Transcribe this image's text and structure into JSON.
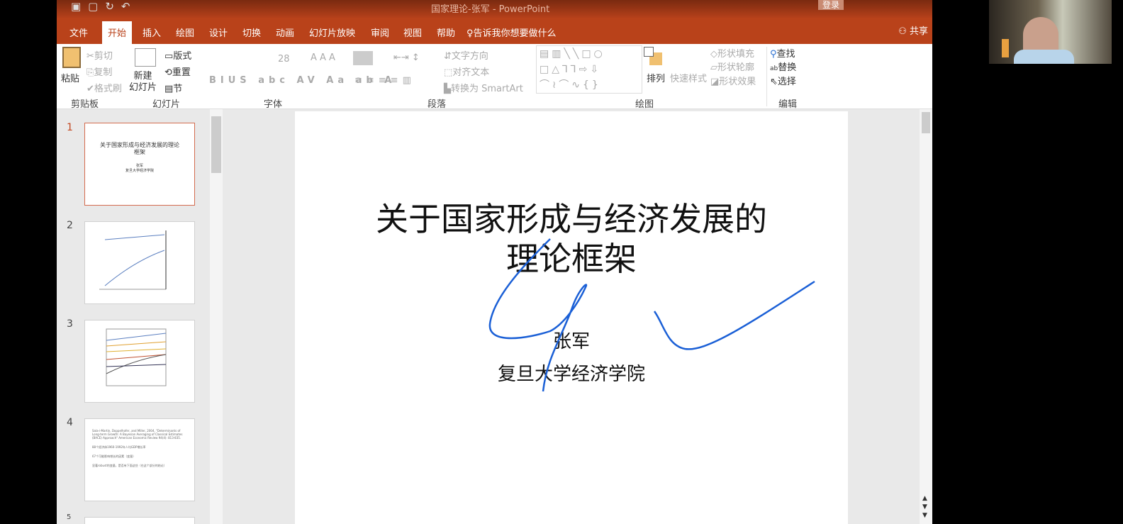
{
  "window": {
    "title": "国家理论-张军  -  PowerPoint",
    "login": "登录",
    "share": "共享"
  },
  "tabs": [
    "文件",
    "开始",
    "插入",
    "绘图",
    "设计",
    "切换",
    "动画",
    "幻灯片放映",
    "审阅",
    "视图",
    "帮助"
  ],
  "tell_me": "告诉我你想要做什么",
  "ribbon": {
    "clipboard": {
      "paste": "粘贴",
      "cut": "剪切",
      "copy": "复制",
      "format_painter": "格式刷",
      "label": "剪贴板"
    },
    "slides": {
      "new_slide": "新建\n幻灯片",
      "layout": "版式",
      "reset": "重置",
      "section": "节",
      "label": "幻灯片"
    },
    "font": {
      "size": "28",
      "label": "字体"
    },
    "paragraph": {
      "text_direction": "文字方向",
      "align_text": "对齐文本",
      "smartart": "转换为 SmartArt",
      "label": "段落"
    },
    "drawing": {
      "arrange": "排列",
      "quick_styles": "快速样式",
      "shape_fill": "形状填充",
      "shape_outline": "形状轮廓",
      "shape_effects": "形状效果",
      "label": "绘图"
    },
    "editing": {
      "find": "查找",
      "replace": "替换",
      "select": "选择",
      "label": "编辑"
    }
  },
  "thumbnails": [
    {
      "num": "1",
      "title": "关于国家形成与经济发展的理论框架",
      "author": "张军",
      "org": "复旦大学经济学院"
    },
    {
      "num": "2"
    },
    {
      "num": "3"
    },
    {
      "num": "4",
      "ref": "Sala-i-Martin, Doppelhofer, and Miller, 2004, \"Determinants of Long-term Growth: A Bayesian Averaging of Classical Estimates (BACE) Approach\" American Economic Review 94(4): 813-835.",
      "bullets": [
        "88个经济体1960-1992年人均GDP增长率",
        "67个可能影响增长的因素（变量）",
        "显著robust的变量，是否有下面这些（在这个部分的结论）"
      ]
    },
    {
      "num": "5"
    }
  ],
  "slide": {
    "title_line1": "关于国家形成与经济发展的",
    "title_line2": "理论框架",
    "author": "张军",
    "org": "复旦大学经济学院"
  },
  "colors": {
    "accent": "#b9421a",
    "ink": "#1a5fd6"
  }
}
